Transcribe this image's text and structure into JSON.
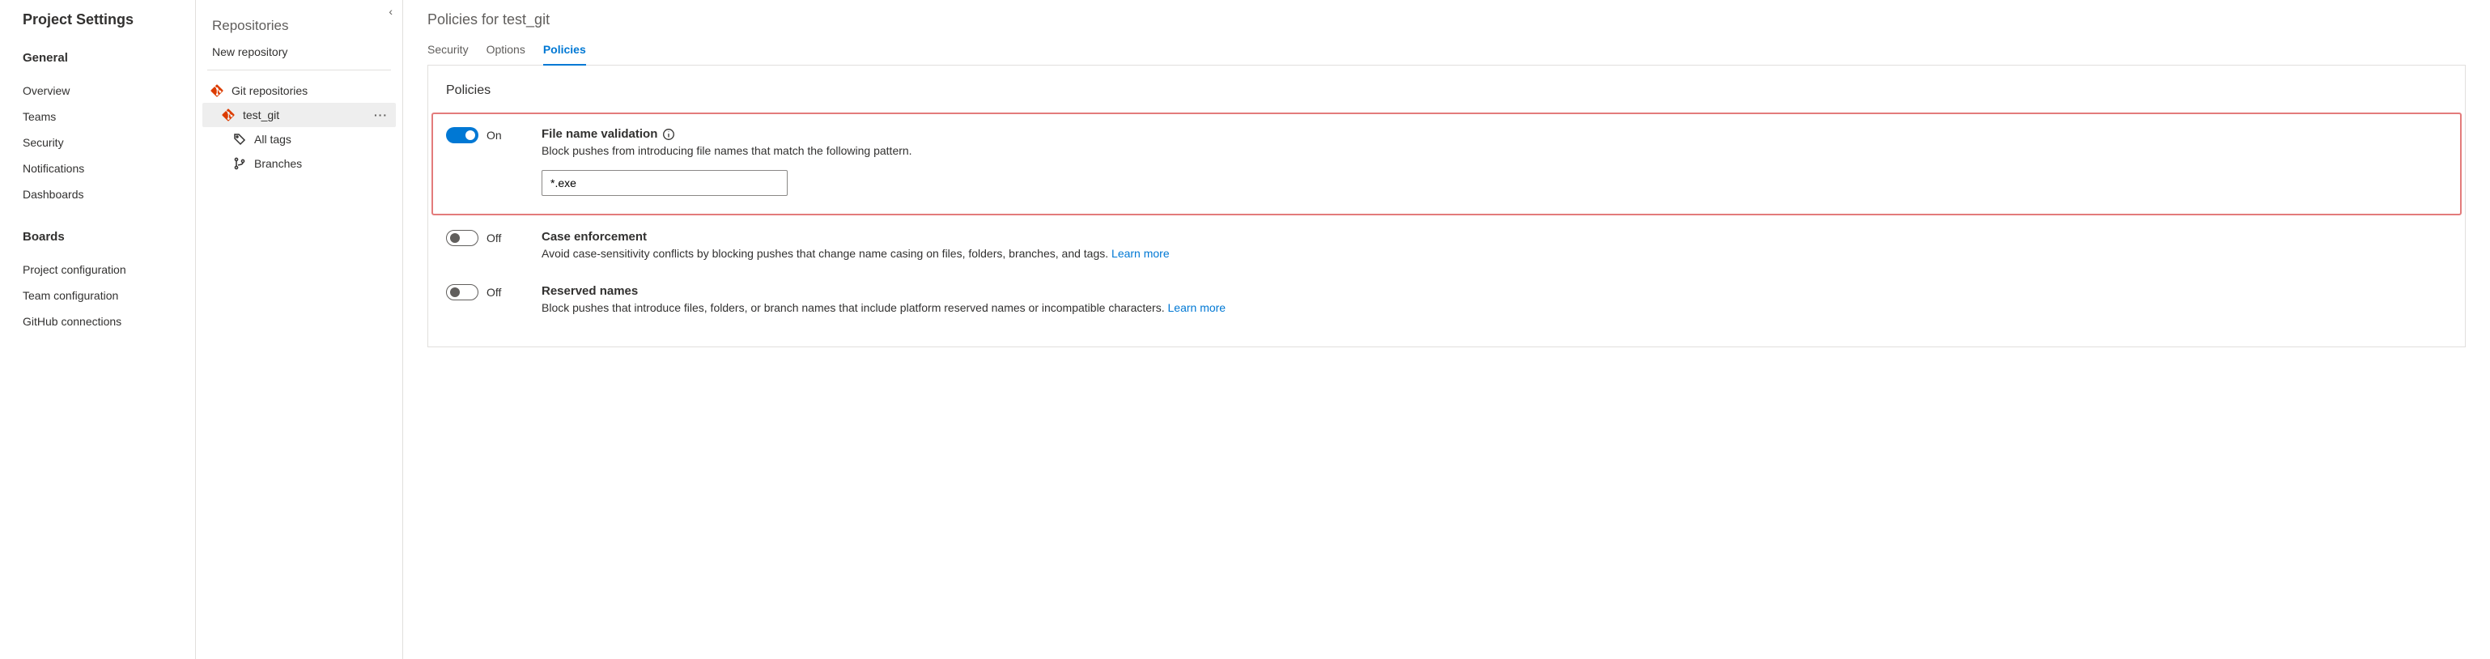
{
  "ps": {
    "title": "Project Settings",
    "sections": [
      {
        "title": "General",
        "items": [
          "Overview",
          "Teams",
          "Security",
          "Notifications",
          "Dashboards"
        ]
      },
      {
        "title": "Boards",
        "items": [
          "Project configuration",
          "Team configuration",
          "GitHub connections"
        ]
      }
    ]
  },
  "repos": {
    "title": "Repositories",
    "new_label": "New repository",
    "root_label": "Git repositories",
    "selected_repo": "test_git",
    "children": [
      {
        "label": "All tags",
        "icon": "tag"
      },
      {
        "label": "Branches",
        "icon": "branch"
      }
    ]
  },
  "main": {
    "title": "Policies for test_git",
    "tabs": [
      {
        "label": "Security",
        "active": false
      },
      {
        "label": "Options",
        "active": false
      },
      {
        "label": "Policies",
        "active": true
      }
    ],
    "section_heading": "Policies",
    "toggle_on": "On",
    "toggle_off": "Off",
    "learn_more": "Learn more",
    "policies": [
      {
        "key": "fnv",
        "on": true,
        "highlight": true,
        "title": "File name validation",
        "desc": "Block pushes from introducing file names that match the following pattern.",
        "has_input": true,
        "input_value": "*.exe",
        "info": true
      },
      {
        "key": "case",
        "on": false,
        "highlight": false,
        "title": "Case enforcement",
        "desc": "Avoid case-sensitivity conflicts by blocking pushes that change name casing on files, folders, branches, and tags. ",
        "learn_more": true
      },
      {
        "key": "reserved",
        "on": false,
        "highlight": false,
        "title": "Reserved names",
        "desc": "Block pushes that introduce files, folders, or branch names that include platform reserved names or incompatible characters. ",
        "learn_more": true
      }
    ]
  }
}
